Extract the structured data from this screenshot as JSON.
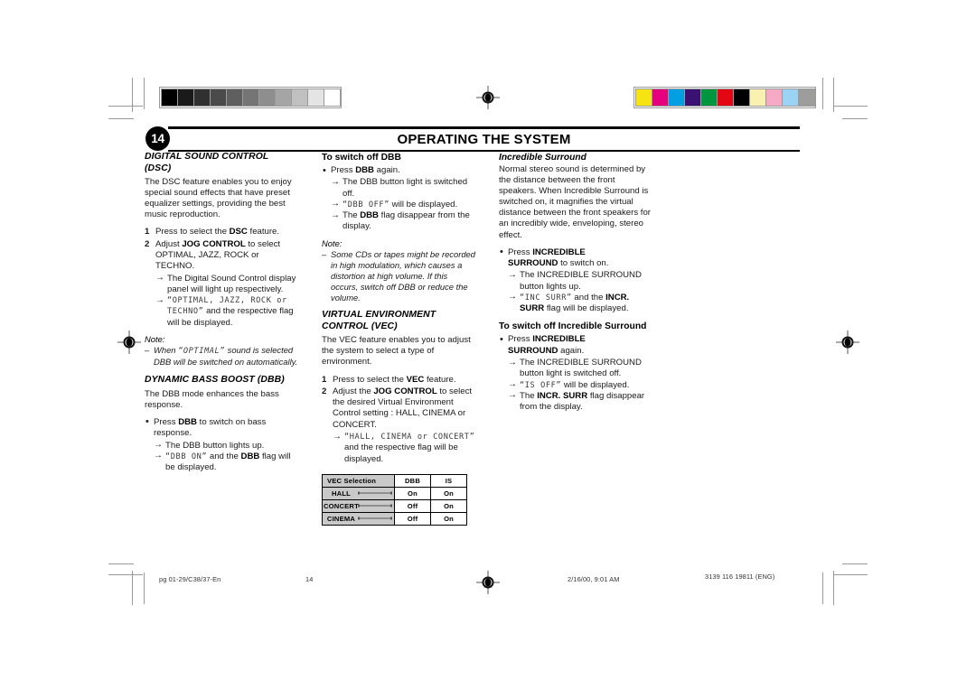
{
  "header": {
    "page_number": "14",
    "title": "OPERATING THE SYSTEM"
  },
  "calibration": {
    "grayscale_label": "grayscale-calibration-bar",
    "grayscale_swatches": [
      "#000000",
      "#1a1a1a",
      "#303030",
      "#4a4a4a",
      "#5f5f5f",
      "#757575",
      "#8e8e8e",
      "#a5a5a5",
      "#c0c0c0",
      "#e4e4e4",
      "#ffffff"
    ],
    "color_label": "color-calibration-bar",
    "color_swatches": [
      "#f6e312",
      "#e5007e",
      "#009fe3",
      "#3b1274",
      "#009640",
      "#e30613",
      "#000000",
      "#faf1b0",
      "#f5a9c4",
      "#9bd3f4",
      "#9d9d9c"
    ]
  },
  "columns": {
    "left": {
      "dsc": {
        "heading_line1": "DIGITAL SOUND CONTROL",
        "heading_line2": "(DSC)",
        "intro": "The DSC feature enables you to enjoy special sound effects that have preset equalizer settings, providing the best music reproduction.",
        "step1_num": "1",
        "step1_text": "Press to select the ",
        "step1_bold": "DSC",
        "step1_tail": " feature.",
        "step2_num": "2",
        "step2_head": "Adjust ",
        "step2_bold": "JOG CONTROL",
        "step2_tail": " to select OPTIMAL, JAZZ, ROCK or TECHNO.",
        "result1": "The Digital Sound Control display panel will light up respectively.",
        "result2_lcd": "“OPTIMAL, JAZZ, ROCK or TECHNO”",
        "result2_tail": " and the respective flag will be displayed.",
        "note_label": "Note:",
        "note_dash": "–",
        "note_text_pre": "When ",
        "note_lcd": "“OPTIMAL”",
        "note_text_post": " sound is selected DBB will be switched on automatically."
      },
      "dbb": {
        "heading": "DYNAMIC BASS BOOST (DBB)",
        "intro": "The DBB mode enhances the bass response.",
        "bullet_pre": "Press ",
        "bullet_bold": "DBB",
        "bullet_post": " to switch on bass response.",
        "result1": "The DBB button lights up.",
        "result2_lcd": "“DBB ON”",
        "result2_mid": " and the ",
        "result2_bold": "DBB",
        "result2_tail": " flag will be displayed."
      }
    },
    "middle": {
      "dbb_off": {
        "heading": "To switch off DBB",
        "bullet_pre": "Press ",
        "bullet_bold": "DBB",
        "bullet_post": " again.",
        "result1": "The DBB button light is switched off.",
        "result2_lcd": "“DBB OFF”",
        "result2_tail": " will be displayed.",
        "result3_pre": "The ",
        "result3_bold": "DBB",
        "result3_post": " flag disappear from the display.",
        "note_label": "Note:",
        "note_dash": "–",
        "note_text": "Some CDs or tapes might be recorded in high modulation, which causes a distortion at high volume. If this occurs, switch off DBB or reduce the volume."
      },
      "vec": {
        "heading_line1": "VIRTUAL ENVIRONMENT",
        "heading_line2": "CONTROL (VEC)",
        "intro": "The VEC feature enables you to adjust the system to select a type of environment.",
        "step1_num": "1",
        "step1_pre": "Press to select the ",
        "step1_bold": "VEC",
        "step1_post": " feature.",
        "step2_num": "2",
        "step2_pre": "Adjust the ",
        "step2_bold": "JOG CONTROL",
        "step2_post": " to select the desired Virtual Environment Control setting : HALL, CINEMA or CONCERT.",
        "result_lcd": "“HALL, CINEMA or CONCERT”",
        "result_tail": " and the respective flag will be displayed."
      },
      "table": {
        "headers": [
          "VEC Selection",
          "DBB",
          "IS"
        ],
        "rows": [
          [
            "HALL",
            "On",
            "On"
          ],
          [
            "CONCERT",
            "Off",
            "On"
          ],
          [
            "CINEMA",
            "Off",
            "On"
          ]
        ]
      }
    },
    "right": {
      "is": {
        "heading": "Incredible Surround",
        "intro": "Normal stereo sound is determined by the distance between the front speakers. When Incredible Surround is switched on, it magnifies the virtual distance between the front speakers for an incredibly wide, enveloping,  stereo effect.",
        "bullet_pre": "Press ",
        "bullet_bold1": "INCREDIBLE",
        "bullet_bold2": "SURROUND",
        "bullet_post": " to switch on.",
        "result1": "The INCREDIBLE SURROUND button lights up.",
        "result2_lcd": "“INC SURR”",
        "result2_mid": " and the ",
        "result2_bold": "INCR. SURR",
        "result2_tail": " flag will be displayed."
      },
      "is_off": {
        "heading": "To switch off Incredible Surround",
        "bullet_pre": "Press ",
        "bullet_bold1": "INCREDIBLE",
        "bullet_bold2": "SURROUND",
        "bullet_post": " again.",
        "result1": "The INCREDIBLE SURROUND button light is switched off.",
        "result2_lcd": "“IS OFF”",
        "result2_tail": " will be displayed.",
        "result3_pre": "The ",
        "result3_bold": "INCR. SURR",
        "result3_post": " flag disappear from the display."
      }
    }
  },
  "footer": {
    "file": "pg 01-29/C38/37-En",
    "page": "14",
    "date": "2/16/00, 9:01 AM",
    "code": "3139 116 19811 (ENG)"
  }
}
